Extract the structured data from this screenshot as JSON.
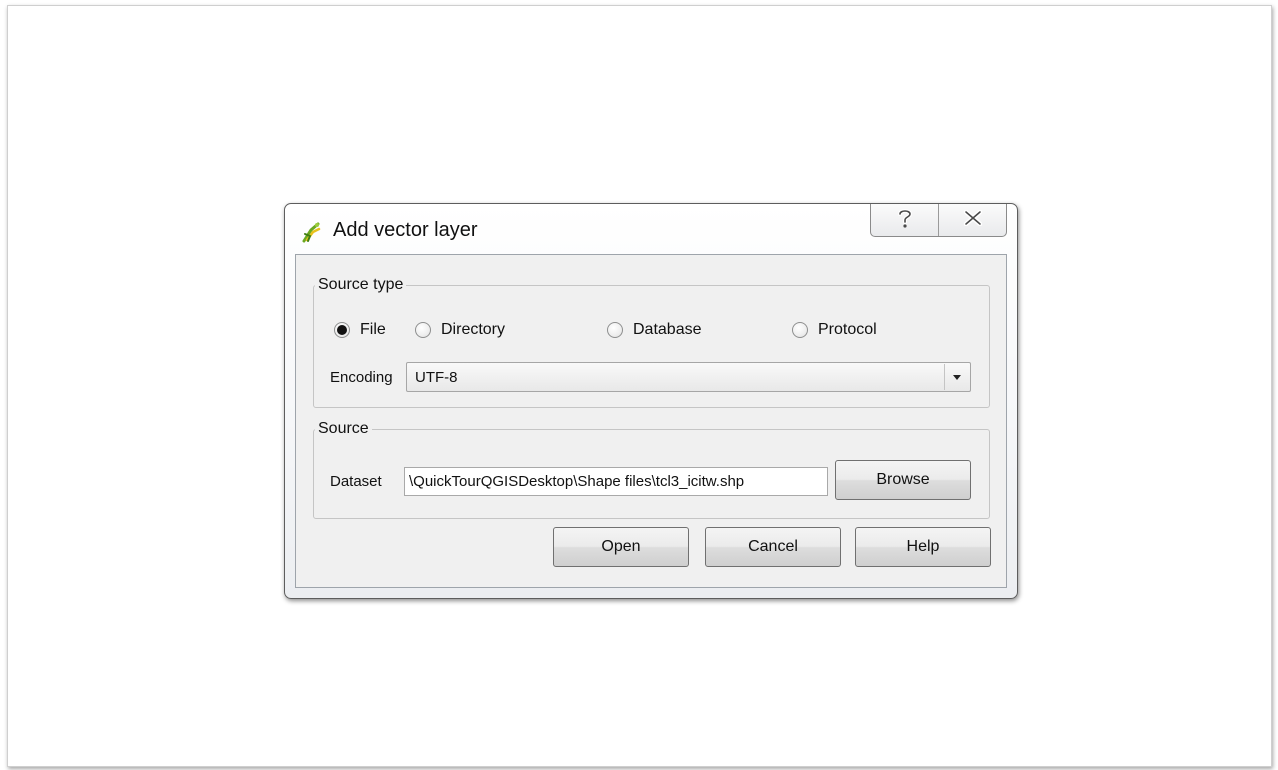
{
  "dialog": {
    "title": "Add vector layer",
    "caption_buttons": {
      "help_icon": "help-question-icon",
      "close_icon": "close-x-icon"
    }
  },
  "source_type": {
    "group_title": "Source type",
    "options": [
      {
        "label": "File",
        "selected": true
      },
      {
        "label": "Directory",
        "selected": false
      },
      {
        "label": "Database",
        "selected": false
      },
      {
        "label": "Protocol",
        "selected": false
      }
    ],
    "encoding_label": "Encoding",
    "encoding_value": "UTF-8"
  },
  "source": {
    "group_title": "Source",
    "dataset_label": "Dataset",
    "dataset_value": "\\QuickTourQGISDesktop\\Shape files\\tcl3_icitw.shp",
    "browse_label": "Browse"
  },
  "buttons": {
    "open": "Open",
    "cancel": "Cancel",
    "help": "Help"
  },
  "colors": {
    "window_bg": "#f0f0f0",
    "border": "#5d5d5d",
    "icon_green": "#6aa820",
    "icon_yellow": "#e8c21c"
  }
}
